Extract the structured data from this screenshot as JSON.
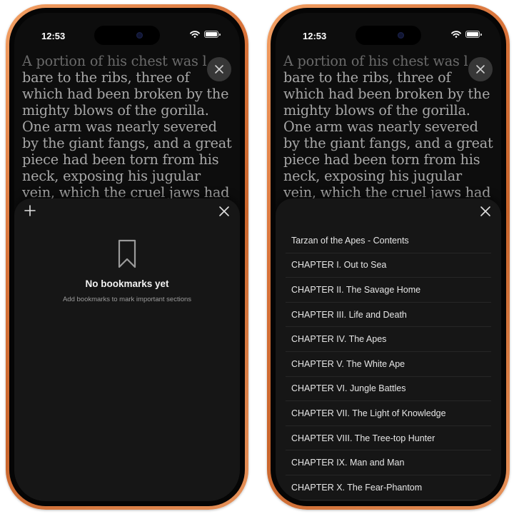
{
  "status_bar": {
    "time": "12:53"
  },
  "reader": {
    "lines": [
      "A portion of his chest was l",
      "bare to the ribs, three of",
      "which had been broken by the",
      "mighty blows of the gorilla.",
      "One arm was nearly severed",
      "by the giant fangs, and a great",
      "piece had been torn from his",
      "neck, exposing his jugular",
      "vein, which the cruel jaws had"
    ]
  },
  "bookmarks_sheet": {
    "empty_title": "No bookmarks yet",
    "empty_subtitle": "Add bookmarks to mark important sections"
  },
  "contents_sheet": {
    "items": [
      "Tarzan of the Apes - Contents",
      "CHAPTER I. Out to Sea",
      "CHAPTER II. The Savage Home",
      "CHAPTER III. Life and Death",
      "CHAPTER IV. The Apes",
      "CHAPTER V. The White Ape",
      "CHAPTER VI. Jungle Battles",
      "CHAPTER VII. The Light of Knowledge",
      "CHAPTER VIII. The Tree-top Hunter",
      "CHAPTER IX. Man and Man",
      "CHAPTER X. The Fear-Phantom"
    ]
  },
  "icons": {
    "close": "close-icon",
    "add": "plus-icon",
    "bookmark": "bookmark-icon"
  },
  "colors": {
    "frame": "#d8733a",
    "sheet_background": "#161616",
    "reader_text": "#a8a8a8"
  }
}
